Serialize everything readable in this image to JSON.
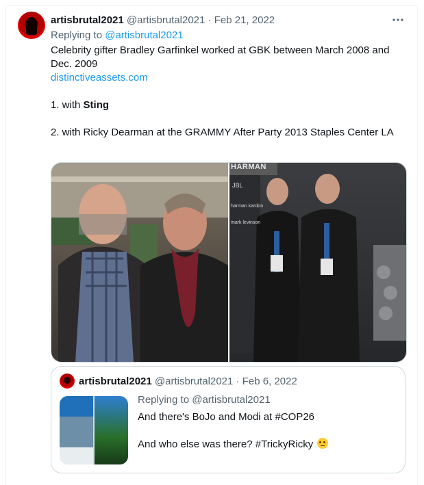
{
  "tweet": {
    "display_name": "artisbrutal2021",
    "handle": "@artisbrutal2021",
    "separator": "·",
    "date": "Feb 21, 2022",
    "more_icon": "more-horizontal-icon",
    "replying_prefix": "Replying to",
    "replying_to": "@artisbrutal2021",
    "text_line1": "Celebrity gifter Bradley Garfinkel worked at GBK between March 2008 and Dec. 2009",
    "link": "distinctiveassets.com",
    "item1_prefix": "1. with ",
    "item1_bold": "Sting",
    "item2": "2. with Ricky Dearman at the GRAMMY After Party 2013 Staples Center LA"
  },
  "media": {
    "photo_right_sign": "HARMAN",
    "photo_right_brands": [
      "JBL",
      "harman kardon",
      "mark levinson"
    ]
  },
  "quote": {
    "display_name": "artisbrutal2021",
    "handle": "@artisbrutal2021",
    "separator": "·",
    "date": "Feb 6, 2022",
    "replying": "Replying to @artisbrutal2021",
    "line1": "And there's BoJo and Modi at #COP26",
    "line2": "And who else was there?  #TrickyRicky",
    "emoji_icon": "face-with-rolling-eyes-icon"
  },
  "colors": {
    "link": "#1d9bf0",
    "muted": "#536471",
    "text": "#0f1419",
    "border": "#cfd9de"
  }
}
